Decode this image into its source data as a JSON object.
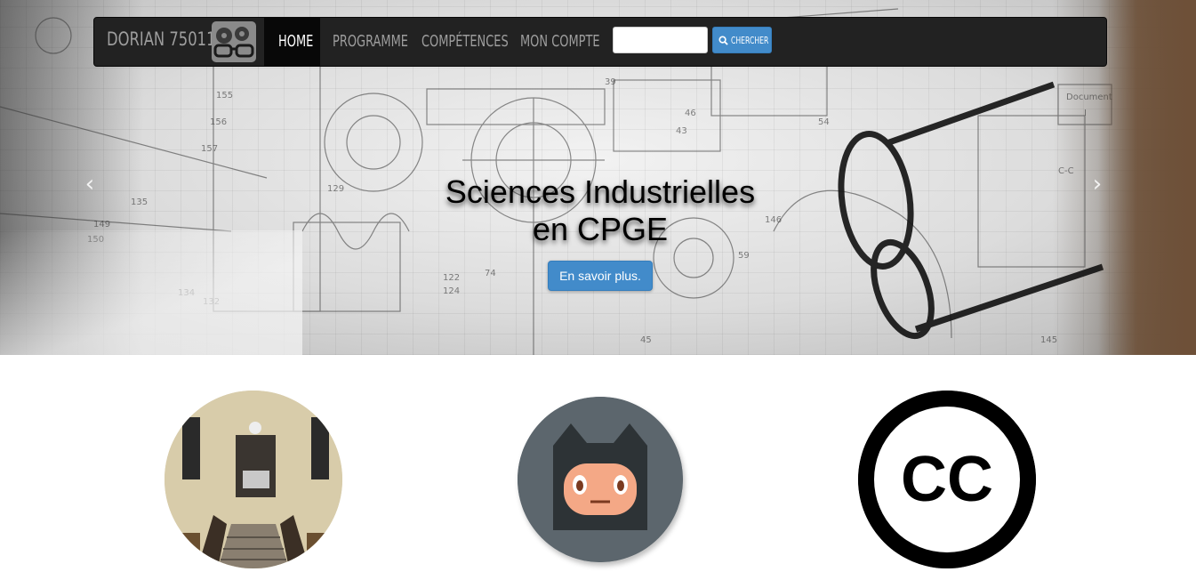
{
  "navbar": {
    "brand": "DORIAN 75011",
    "logo_icon": "gears-glasses-logo",
    "items": [
      {
        "label": "HOME",
        "active": true
      },
      {
        "label": "PROGRAMME",
        "active": false
      },
      {
        "label": "COMPÉTENCES",
        "active": false
      },
      {
        "label": "MON COMPTE",
        "active": false
      }
    ],
    "search": {
      "value": "",
      "button_label": "CHERCHER",
      "button_icon": "search-icon"
    }
  },
  "carousel": {
    "title_line1": "Sciences Industrielles",
    "title_line2": "en CPGE",
    "button_label": "En savoir plus.",
    "prev_glyph": "‹",
    "next_glyph": "›"
  },
  "features": [
    {
      "name": "school-staircase-photo"
    },
    {
      "name": "github-octocat-avatar"
    },
    {
      "name": "creative-commons-logo",
      "text": "CC"
    }
  ],
  "colors": {
    "navbar_bg": "#222222",
    "nav_text": "#9d9d9d",
    "primary": "#428bca"
  }
}
